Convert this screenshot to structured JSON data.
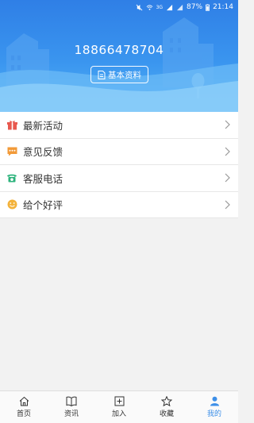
{
  "status_bar": {
    "battery": "87%",
    "time": "21:14",
    "network": "3G"
  },
  "profile": {
    "phone": "18866478704",
    "info_button_label": "基本资料"
  },
  "menu": {
    "items": [
      {
        "label": "最新活动",
        "icon": "gift-icon",
        "color": "#e8594f"
      },
      {
        "label": "意见反馈",
        "icon": "chat-bubble-icon",
        "color": "#f29a38"
      },
      {
        "label": "客服电话",
        "icon": "telephone-icon",
        "color": "#2db37c"
      },
      {
        "label": "给个好评",
        "icon": "smile-icon",
        "color": "#f3b23a"
      }
    ]
  },
  "tabbar": {
    "items": [
      {
        "label": "首页",
        "icon": "home-icon"
      },
      {
        "label": "资讯",
        "icon": "book-icon"
      },
      {
        "label": "加入",
        "icon": "plus-box-icon"
      },
      {
        "label": "收藏",
        "icon": "star-icon"
      },
      {
        "label": "我的",
        "icon": "person-icon",
        "active": true
      }
    ]
  },
  "colors": {
    "header_blue": "#3a8ff0",
    "accent": "#3d8fe8"
  }
}
